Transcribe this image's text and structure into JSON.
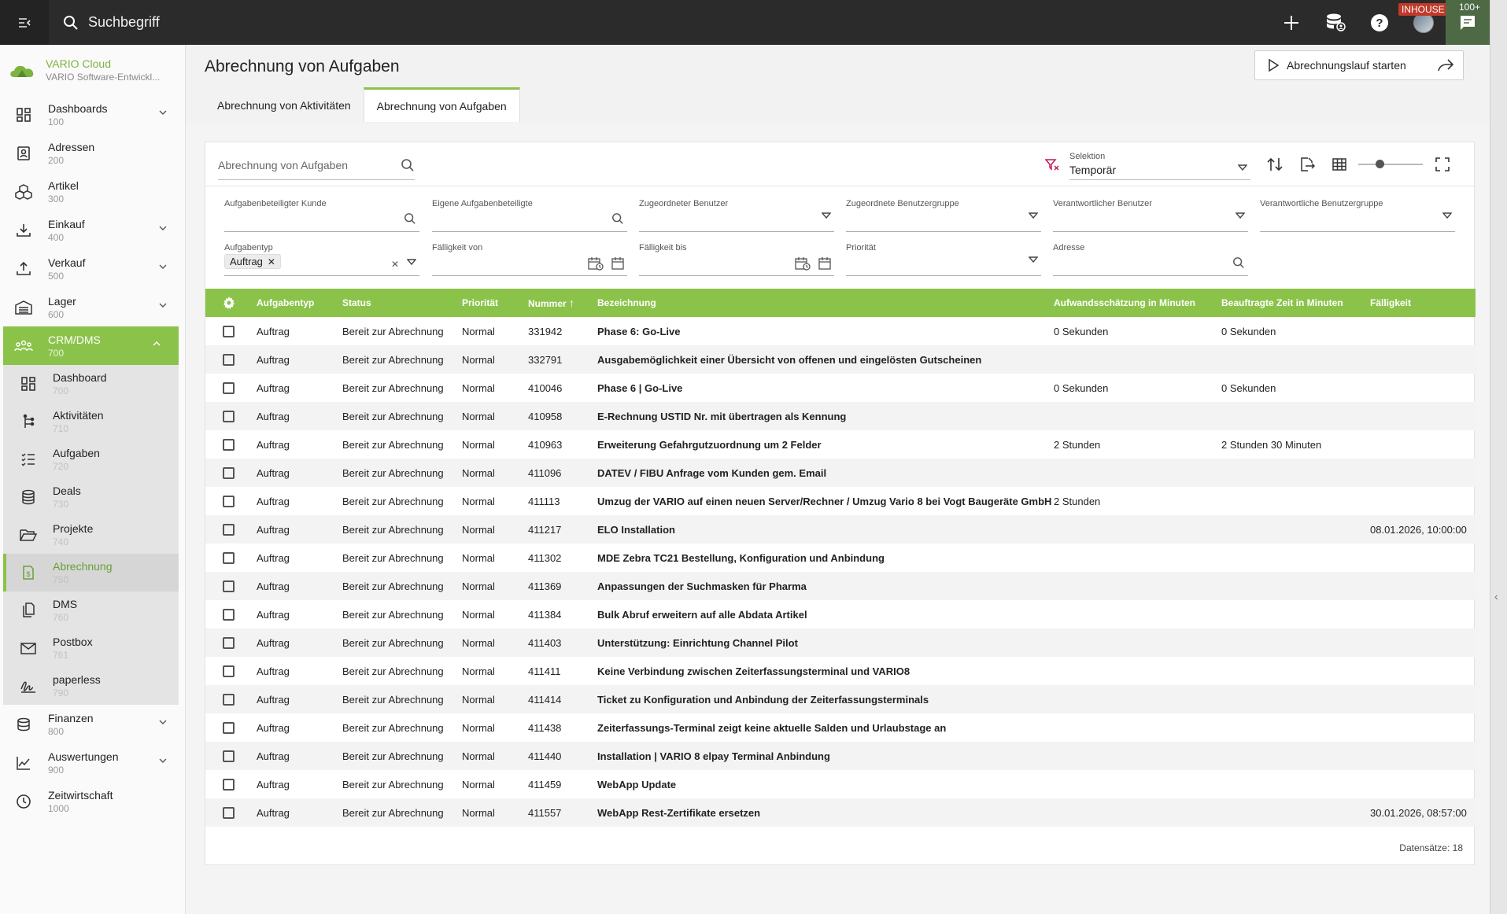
{
  "topbar": {
    "search_placeholder": "Suchbegriff",
    "inhouse_badge": "INHOUSE",
    "chat_count": "100+"
  },
  "brand": {
    "name": "VARIO Cloud",
    "sub": "VARIO Software-Entwickl..."
  },
  "sidebar": {
    "items": [
      {
        "label": "Dashboards",
        "code": "100",
        "icon": "dashboard-icon",
        "chevron": true
      },
      {
        "label": "Adressen",
        "code": "200",
        "icon": "contacts-icon",
        "chevron": false
      },
      {
        "label": "Artikel",
        "code": "300",
        "icon": "boxes-icon",
        "chevron": false
      },
      {
        "label": "Einkauf",
        "code": "400",
        "icon": "download-tray-icon",
        "chevron": true
      },
      {
        "label": "Verkauf",
        "code": "500",
        "icon": "upload-tray-icon",
        "chevron": true
      },
      {
        "label": "Lager",
        "code": "600",
        "icon": "warehouse-icon",
        "chevron": true
      },
      {
        "label": "CRM/DMS",
        "code": "700",
        "icon": "people-icon",
        "chevron": true
      }
    ],
    "sub_items": [
      {
        "label": "Dashboard",
        "code": "700",
        "icon": "dashboard-icon"
      },
      {
        "label": "Aktivitäten",
        "code": "710",
        "icon": "activity-tree-icon"
      },
      {
        "label": "Aufgaben",
        "code": "720",
        "icon": "checklist-icon"
      },
      {
        "label": "Deals",
        "code": "730",
        "icon": "coins-icon"
      },
      {
        "label": "Projekte",
        "code": "740",
        "icon": "folder-open-icon"
      },
      {
        "label": "Abrechnung",
        "code": "750",
        "icon": "invoice-icon"
      },
      {
        "label": "DMS",
        "code": "760",
        "icon": "documents-icon"
      },
      {
        "label": "Postbox",
        "code": "761",
        "icon": "mail-icon"
      },
      {
        "label": "paperless",
        "code": "790",
        "icon": "signature-icon"
      }
    ],
    "bottom_items": [
      {
        "label": "Finanzen",
        "code": "800",
        "icon": "finance-icon",
        "chevron": true
      },
      {
        "label": "Auswertungen",
        "code": "900",
        "icon": "chart-line-icon",
        "chevron": true
      },
      {
        "label": "Zeitwirtschaft",
        "code": "1000",
        "icon": "clock-icon",
        "chevron": false
      }
    ]
  },
  "page": {
    "title": "Abrechnung von Aufgaben",
    "start_button": "Abrechnungslauf starten",
    "tabs": [
      "Abrechnung von Aktivitäten",
      "Abrechnung von Aufgaben"
    ],
    "active_tab": 1
  },
  "toolbar": {
    "search_placeholder": "Abrechnung von Aufgaben",
    "selection_label": "Selektion",
    "selection_value": "Temporär"
  },
  "filters": {
    "row1": [
      {
        "label": "Aufgabenbeteiligter Kunde",
        "icon": "search"
      },
      {
        "label": "Eigene Aufgabenbeteiligte",
        "icon": "search"
      },
      {
        "label": "Zugeordneter Benutzer",
        "icon": "dropdown"
      },
      {
        "label": "Zugeordnete Benutzergruppe",
        "icon": "dropdown"
      },
      {
        "label": "Verantwortlicher Benutzer",
        "icon": "dropdown"
      },
      {
        "label": "Verantwortliche Benutzergruppe",
        "icon": "dropdown"
      }
    ],
    "aufgabentyp_label": "Aufgabentyp",
    "aufgabentyp_chip": "Auftrag",
    "faelligkeit_von": "Fälligkeit von",
    "faelligkeit_bis": "Fälligkeit bis",
    "prioritaet": "Priorität",
    "adresse": "Adresse"
  },
  "table": {
    "columns": [
      "Aufgabentyp",
      "Status",
      "Priorität",
      "Nummer",
      "Bezeichnung",
      "Aufwandsschätzung in Minuten",
      "Beauftragte Zeit in Minuten",
      "Fälligkeit"
    ],
    "rows": [
      [
        "Auftrag",
        "Bereit zur Abrechnung",
        "Normal",
        "331942",
        "Phase 6: Go-Live",
        "0 Sekunden",
        "0 Sekunden",
        ""
      ],
      [
        "Auftrag",
        "Bereit zur Abrechnung",
        "Normal",
        "332791",
        "Ausgabemöglichkeit einer Übersicht von offenen und eingelösten Gutscheinen",
        "",
        "",
        ""
      ],
      [
        "Auftrag",
        "Bereit zur Abrechnung",
        "Normal",
        "410046",
        "Phase 6 | Go-Live",
        "0 Sekunden",
        "0 Sekunden",
        ""
      ],
      [
        "Auftrag",
        "Bereit zur Abrechnung",
        "Normal",
        "410958",
        "E-Rechnung USTID Nr. mit übertragen als Kennung",
        "",
        "",
        ""
      ],
      [
        "Auftrag",
        "Bereit zur Abrechnung",
        "Normal",
        "410963",
        "Erweiterung Gefahrgutzuordnung um 2 Felder",
        "2 Stunden",
        "2 Stunden 30 Minuten",
        ""
      ],
      [
        "Auftrag",
        "Bereit zur Abrechnung",
        "Normal",
        "411096",
        "DATEV / FIBU Anfrage vom Kunden gem. Email",
        "",
        "",
        ""
      ],
      [
        "Auftrag",
        "Bereit zur Abrechnung",
        "Normal",
        "411113",
        "Umzug der VARIO auf einen neuen Server/Rechner / Umzug Vario 8 bei Vogt Baugeräte GmbH",
        "2 Stunden",
        "",
        ""
      ],
      [
        "Auftrag",
        "Bereit zur Abrechnung",
        "Normal",
        "411217",
        "ELO Installation",
        "",
        "",
        "08.01.2026, 10:00:00"
      ],
      [
        "Auftrag",
        "Bereit zur Abrechnung",
        "Normal",
        "411302",
        "MDE Zebra TC21 Bestellung, Konfiguration und Anbindung",
        "",
        "",
        ""
      ],
      [
        "Auftrag",
        "Bereit zur Abrechnung",
        "Normal",
        "411369",
        "Anpassungen der Suchmasken für Pharma",
        "",
        "",
        ""
      ],
      [
        "Auftrag",
        "Bereit zur Abrechnung",
        "Normal",
        "411384",
        "Bulk Abruf erweitern auf alle Abdata Artikel",
        "",
        "",
        ""
      ],
      [
        "Auftrag",
        "Bereit zur Abrechnung",
        "Normal",
        "411403",
        "Unterstützung: Einrichtung Channel Pilot",
        "",
        "",
        ""
      ],
      [
        "Auftrag",
        "Bereit zur Abrechnung",
        "Normal",
        "411411",
        "Keine Verbindung zwischen Zeiterfassungsterminal und VARIO8",
        "",
        "",
        ""
      ],
      [
        "Auftrag",
        "Bereit zur Abrechnung",
        "Normal",
        "411414",
        "Ticket zu Konfiguration und Anbindung der Zeiterfassungsterminals",
        "",
        "",
        ""
      ],
      [
        "Auftrag",
        "Bereit zur Abrechnung",
        "Normal",
        "411438",
        "Zeiterfassungs-Terminal zeigt keine aktuelle Salden und Urlaubstage an",
        "",
        "",
        ""
      ],
      [
        "Auftrag",
        "Bereit zur Abrechnung",
        "Normal",
        "411440",
        "Installation | VARIO 8 elpay Terminal Anbindung",
        "",
        "",
        ""
      ],
      [
        "Auftrag",
        "Bereit zur Abrechnung",
        "Normal",
        "411459",
        "WebApp Update",
        "",
        "",
        ""
      ],
      [
        "Auftrag",
        "Bereit zur Abrechnung",
        "Normal",
        "411557",
        "WebApp Rest-Zertifikate ersetzen",
        "",
        "",
        "30.01.2026, 08:57:00"
      ]
    ],
    "footer": "Datensätze: 18"
  },
  "colors": {
    "accent": "#8bc34a",
    "topbar": "#2b2b2b",
    "badge": "#c0392b"
  }
}
